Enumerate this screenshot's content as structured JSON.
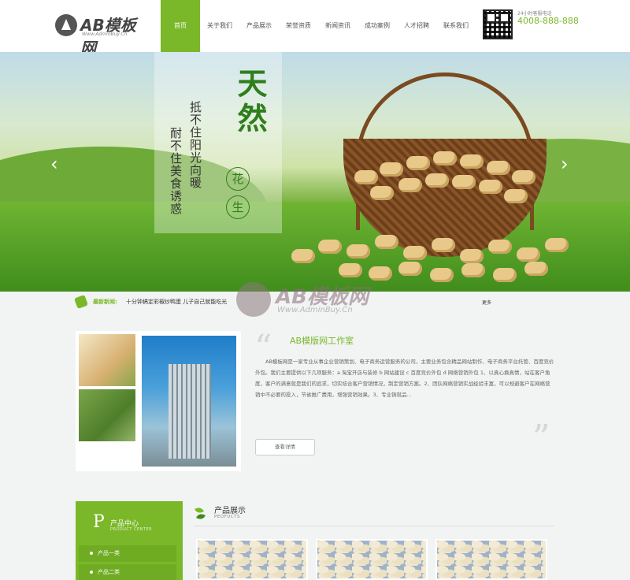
{
  "header": {
    "logo_text": "AB模板网",
    "logo_url": "Www.AdminBuy.Cn",
    "nav": [
      "首页",
      "关于我们",
      "产品展示",
      "荣誉资质",
      "新闻资讯",
      "成功案例",
      "人才招聘",
      "联系我们"
    ],
    "hotline_label": "24小时客服电话",
    "hotline_number": "4008-888-888"
  },
  "banner": {
    "headline": "天然",
    "seal_1": "花",
    "seal_2": "生",
    "line_1": "抵不住阳光向暖",
    "line_2": "耐不住美食诱惑",
    "prev": "‹",
    "next": "›"
  },
  "news": {
    "label": "最新新闻:",
    "headline": "十分钟搞定彩椒炒鸭蛋 儿子自己就能吃光",
    "more": "更多"
  },
  "watermark": {
    "text": "AB模板网",
    "url": "Www.AdminBuy.Cn"
  },
  "about": {
    "title": "AB模版网工作室",
    "body": "AB模板网是一家专业从事企业营销策划、电子商务运营服务的公司，主要业务包含精品网站制作、电子商务平台托管、百度竞价外包。我们主要提供以下几项服务：a 淘宝开店与装修 b 网站建设 c 百度竞价外包 d 网络营销外包 1、以真心换真情，站在客户角度，客户的满意就是我们的追求，切实结合客户营销情况，制定营销方案。2、团队网络营销实战经验丰富，可以规避客户在网络营销中不必要的投入，节省推广费用，增强营销效果。3、专业铸就品...",
    "quote_open": "“",
    "quote_close": "”",
    "more_button": "查看详情"
  },
  "sidebar": {
    "letter": "P",
    "title": "产品中心",
    "subtitle": "PRODUCT CENTER",
    "items": [
      "产品一类",
      "产品二类"
    ]
  },
  "products": {
    "title": "产品展示",
    "subtitle": "PEOFUCTS"
  },
  "colors": {
    "accent": "#7ab829",
    "background": "#f1f4f3"
  }
}
